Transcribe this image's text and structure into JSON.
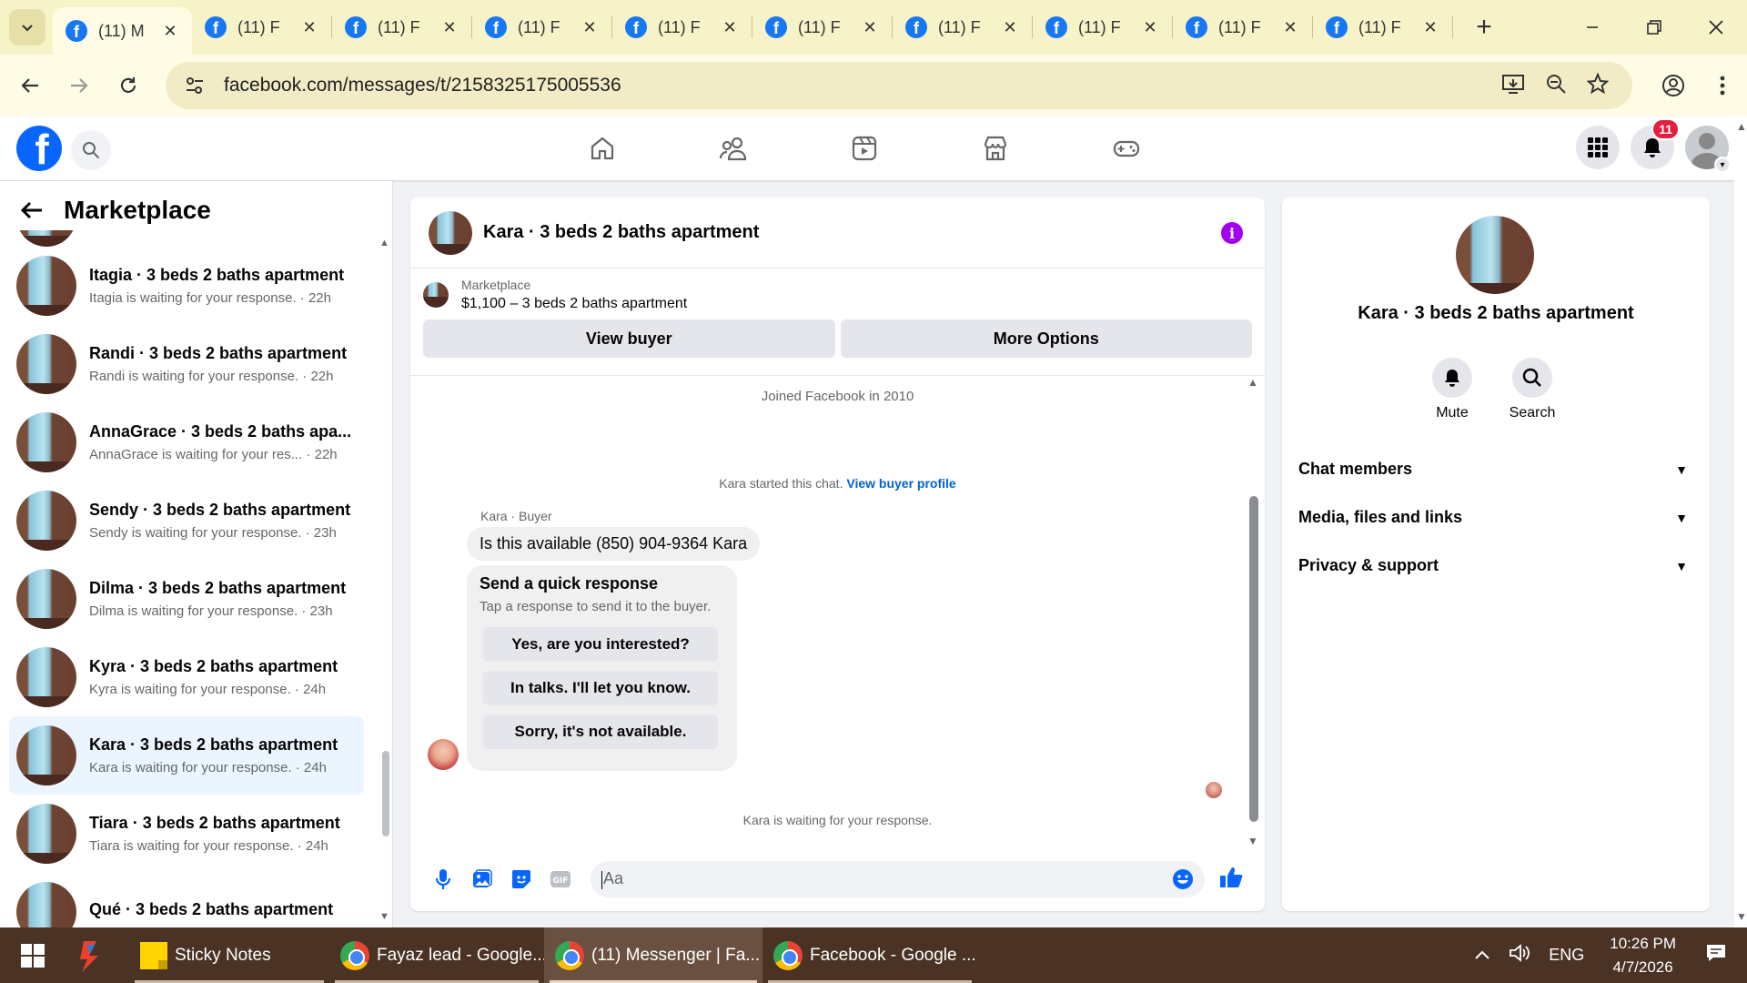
{
  "browser": {
    "tabs": [
      {
        "title": "(11) M",
        "active": true
      },
      {
        "title": "(11) F",
        "active": false
      },
      {
        "title": "(11) F",
        "active": false
      },
      {
        "title": "(11) F",
        "active": false
      },
      {
        "title": "(11) F",
        "active": false
      },
      {
        "title": "(11) F",
        "active": false
      },
      {
        "title": "(11) F",
        "active": false
      },
      {
        "title": "(11) F",
        "active": false
      },
      {
        "title": "(11) F",
        "active": false
      },
      {
        "title": "(11) F",
        "active": false
      }
    ],
    "url": "facebook.com/messages/t/2158325175005536"
  },
  "fb_header": {
    "logo_letter": "f",
    "notification_count": "11"
  },
  "sidebar": {
    "title": "Marketplace",
    "conversations": [
      {
        "title": "Itagia · 3 beds 2 baths apartment",
        "subtitle": "Itagia is waiting for your response. · 22h",
        "selected": false
      },
      {
        "title": "Randi · 3 beds 2 baths apartment",
        "subtitle": "Randi is waiting for your response. · 22h",
        "selected": false
      },
      {
        "title": "AnnaGrace · 3 beds 2 baths apa...",
        "subtitle": "AnnaGrace is waiting for your res... · 22h",
        "selected": false
      },
      {
        "title": "Sendy · 3 beds 2 baths apartment",
        "subtitle": "Sendy is waiting for your response. · 23h",
        "selected": false
      },
      {
        "title": "Dilma · 3 beds 2 baths apartment",
        "subtitle": "Dilma is waiting for your response. · 23h",
        "selected": false
      },
      {
        "title": "Kyra · 3 beds 2 baths apartment",
        "subtitle": "Kyra is waiting for your response. · 24h",
        "selected": false
      },
      {
        "title": "Kara · 3 beds 2 baths apartment",
        "subtitle": "Kara is waiting for your response. · 24h",
        "selected": true
      },
      {
        "title": "Tiara · 3 beds 2 baths apartment",
        "subtitle": "Tiara is waiting for your response. · 24h",
        "selected": false
      },
      {
        "title": "Qué · 3 beds 2 baths apartment",
        "subtitle": "",
        "selected": false
      }
    ]
  },
  "chat": {
    "title": "Kara · 3 beds 2 baths apartment",
    "listing_label": "Marketplace",
    "listing_price": "$1,100 – 3 beds 2 baths apartment",
    "view_buyer_label": "View buyer",
    "more_options_label": "More Options",
    "joined_text": "Joined Facebook in 2010",
    "started_text": "Kara started this chat.",
    "view_profile_link": "View buyer profile",
    "sender_label": "Kara · Buyer",
    "message": "Is this available (850) 904-9364 Kara",
    "quick_title": "Send a quick response",
    "quick_subtitle": "Tap a response to send it to the buyer.",
    "quick_replies": [
      "Yes, are you interested?",
      "In talks. I'll let you know.",
      "Sorry, it's not available."
    ],
    "waiting_text": "Kara is waiting for your response.",
    "composer_placeholder": "Aa"
  },
  "info_panel": {
    "name": "Kara · 3 beds 2 baths apartment",
    "actions": [
      {
        "label": "Mute",
        "icon": "bell-icon"
      },
      {
        "label": "Search",
        "icon": "search-icon"
      }
    ],
    "sections": [
      "Chat members",
      "Media, files and links",
      "Privacy & support"
    ]
  },
  "taskbar": {
    "items": [
      {
        "label": "Sticky Notes"
      },
      {
        "label": "Fayaz lead - Google..."
      },
      {
        "label": "(11) Messenger | Fa..."
      },
      {
        "label": "Facebook - Google ..."
      }
    ],
    "language": "ENG",
    "time": "10:26 PM",
    "date": "4/7/2026"
  },
  "colors": {
    "facebook_blue": "#0866ff",
    "tab_strip": "#f7f3c9",
    "selected_convo": "#ebf5ff",
    "info_purple": "#a300f2",
    "notification_red": "#e41e3f",
    "taskbar": "#4a3225"
  }
}
